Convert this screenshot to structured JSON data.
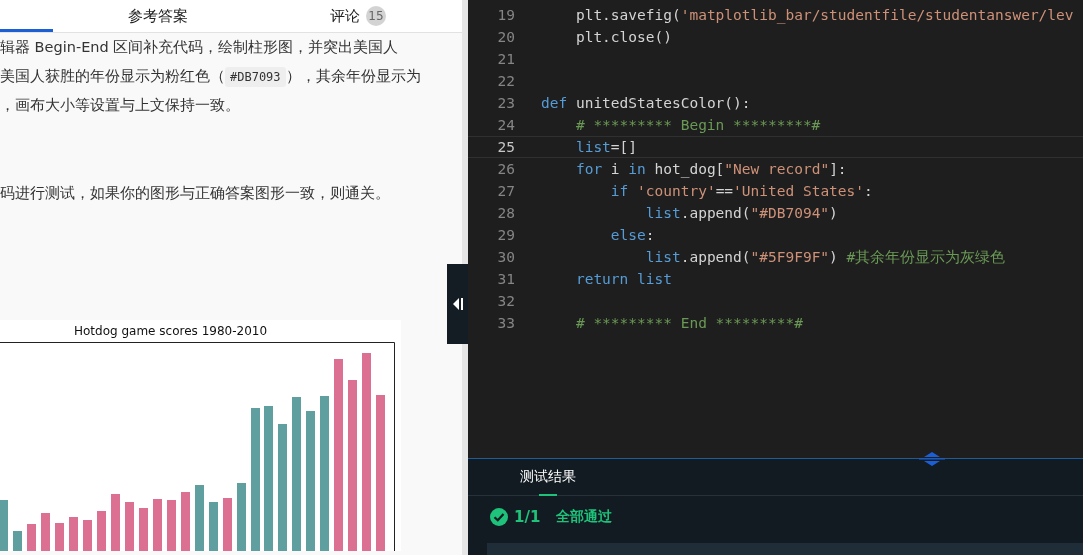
{
  "left_panel": {
    "tabs": [
      {
        "selected": true
      },
      {
        "label": "参考答案",
        "selected": false
      },
      {
        "label": "评论",
        "badge": "15",
        "selected": false
      }
    ],
    "paragraph_lines": [
      {
        "text": "辑器 Begin-End 区间补充代码，绘制柱形图，并突出美国人"
      },
      {
        "text": "美国人获胜的年份显示为粉红色（",
        "code": "#DB7093",
        "after": "），其余年份显示为"
      },
      {
        "text": "，画布大小等设置与上文保持一致。"
      }
    ],
    "instruction": "码进行测试，如果你的图形与正确答案图形一致，则通关。",
    "chart": {
      "title": "Hotdog game scores 1980-2010"
    }
  },
  "editor": {
    "lines": [
      {
        "number": "19",
        "active": false,
        "tokens": [
          {
            "text": "    plt.savefig(",
            "kind": "plain"
          },
          {
            "text": "'matplotlib_bar/studentfile/studentanswer/lev",
            "kind": "string"
          }
        ]
      },
      {
        "number": "20",
        "active": false,
        "tokens": [
          {
            "text": "    plt.close()",
            "kind": "plain"
          }
        ]
      },
      {
        "number": "21",
        "active": false
      },
      {
        "number": "22",
        "active": false
      },
      {
        "number": "23",
        "active": false,
        "tokens": [
          {
            "text": "def",
            "kind": "keyword"
          },
          {
            "text": " unitedStatesColor():",
            "kind": "plain"
          }
        ]
      },
      {
        "number": "24",
        "active": false,
        "tokens": [
          {
            "text": "    # ********* Begin *********#",
            "kind": "comment"
          }
        ]
      },
      {
        "number": "25",
        "active": true,
        "tokens": [
          {
            "text": "    list",
            "kind": "keyword"
          },
          {
            "text": "=[]",
            "kind": "plain"
          }
        ]
      },
      {
        "number": "26",
        "active": false,
        "tokens": [
          {
            "text": "    for",
            "kind": "keyword"
          },
          {
            "text": " i ",
            "kind": "plain"
          },
          {
            "text": "in",
            "kind": "keyword"
          },
          {
            "text": " hot_dog[",
            "kind": "plain"
          },
          {
            "text": "\"New record\"",
            "kind": "string"
          },
          {
            "text": "]:",
            "kind": "plain"
          }
        ]
      },
      {
        "number": "27",
        "active": false,
        "tokens": [
          {
            "text": "        if",
            "kind": "keyword"
          },
          {
            "text": " 'country'",
            "kind": "string"
          },
          {
            "text": "==",
            "kind": "plain"
          },
          {
            "text": "'United States'",
            "kind": "string"
          },
          {
            "text": ":",
            "kind": "plain"
          }
        ]
      },
      {
        "number": "28",
        "active": false,
        "tokens": [
          {
            "text": "            list",
            "kind": "keyword"
          },
          {
            "text": ".append(",
            "kind": "plain"
          },
          {
            "text": "\"#DB7094\"",
            "kind": "string"
          },
          {
            "text": ")",
            "kind": "plain"
          }
        ]
      },
      {
        "number": "29",
        "active": false,
        "tokens": [
          {
            "text": "        else",
            "kind": "keyword"
          },
          {
            "text": ":",
            "kind": "plain"
          }
        ]
      },
      {
        "number": "30",
        "active": false,
        "tokens": [
          {
            "text": "            list",
            "kind": "keyword"
          },
          {
            "text": ".append(",
            "kind": "plain"
          },
          {
            "text": "\"#5F9F9F\"",
            "kind": "string"
          },
          {
            "text": ") ",
            "kind": "plain"
          },
          {
            "text": "#其余年份显示为灰绿色",
            "kind": "comment"
          }
        ]
      },
      {
        "number": "31",
        "active": false,
        "tokens": [
          {
            "text": "    return list",
            "kind": "keyword"
          }
        ]
      },
      {
        "number": "32",
        "active": false
      },
      {
        "number": "33",
        "active": false,
        "tokens": [
          {
            "text": "    # ********* End *********#",
            "kind": "comment"
          }
        ]
      }
    ]
  },
  "results_panel": {
    "tabs": [
      {
        "label": "测试结果",
        "selected": true
      }
    ],
    "summary": {
      "count": "1/1",
      "status": "全部通过"
    }
  }
}
